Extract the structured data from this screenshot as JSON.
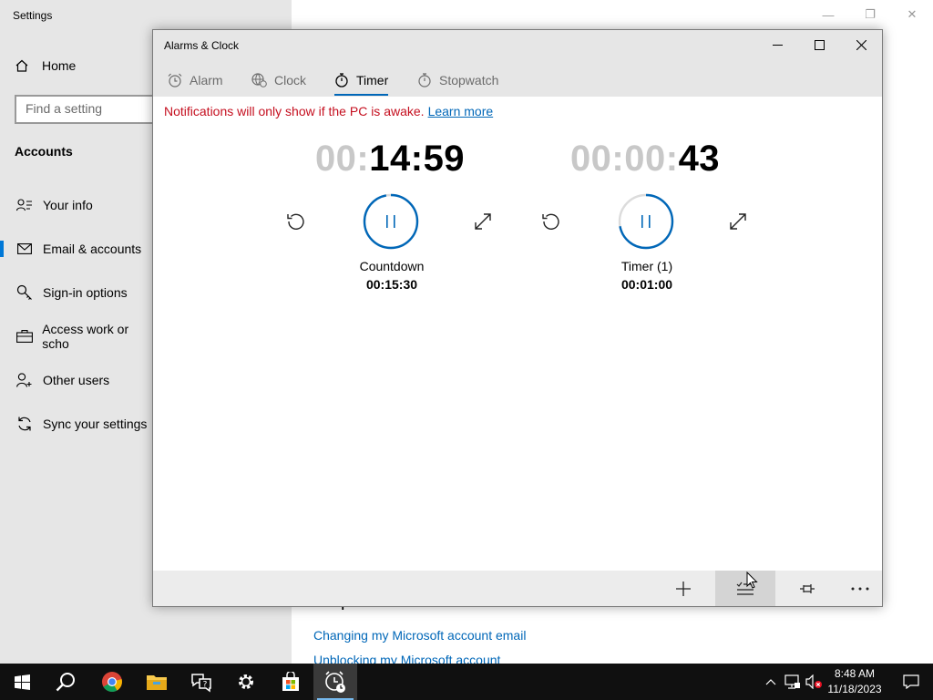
{
  "settings": {
    "title": "Settings",
    "home_label": "Home",
    "search_placeholder": "Find a setting",
    "section_heading": "Accounts",
    "nav_items": [
      {
        "label": "Your info",
        "icon": "person-card-icon"
      },
      {
        "label": "Email & accounts",
        "icon": "mail-icon",
        "active": true
      },
      {
        "label": "Sign-in options",
        "icon": "key-icon"
      },
      {
        "label": "Access work or scho",
        "icon": "briefcase-icon"
      },
      {
        "label": "Other users",
        "icon": "person-add-icon"
      },
      {
        "label": "Sync your settings",
        "icon": "sync-icon"
      }
    ],
    "help_heading": "Help from the web",
    "help_links": [
      "Changing my Microsoft account email",
      "Unblocking my Microsoft account"
    ]
  },
  "alarms": {
    "title": "Alarms & Clock",
    "tabs": [
      {
        "label": "Alarm",
        "icon": "alarm-icon"
      },
      {
        "label": "Clock",
        "icon": "globe-icon"
      },
      {
        "label": "Timer",
        "icon": "stopwatch-icon",
        "active": true
      },
      {
        "label": "Stopwatch",
        "icon": "stopwatch-icon"
      }
    ],
    "notice": "Notifications will only show if the PC is awake.",
    "notice_link": "Learn more",
    "timers": [
      {
        "dim": "00:",
        "bright": "14:59",
        "name": "Countdown",
        "duration": "00:15:30",
        "progress": 0.97
      },
      {
        "dim": "00:00:",
        "bright": "43",
        "name": "Timer (1)",
        "duration": "00:01:00",
        "progress": 0.72
      }
    ]
  },
  "taskbar": {
    "apps": [
      "start-icon",
      "search-icon",
      "chrome-icon",
      "file-explorer-icon",
      "feedback-hub-icon",
      "settings-icon",
      "store-icon",
      "alarms-icon"
    ],
    "time": "8:48 AM",
    "date": "11/18/2023"
  },
  "colors": {
    "accent": "#0067b8",
    "warning": "#c50f1f",
    "taskbar": "#101010"
  }
}
